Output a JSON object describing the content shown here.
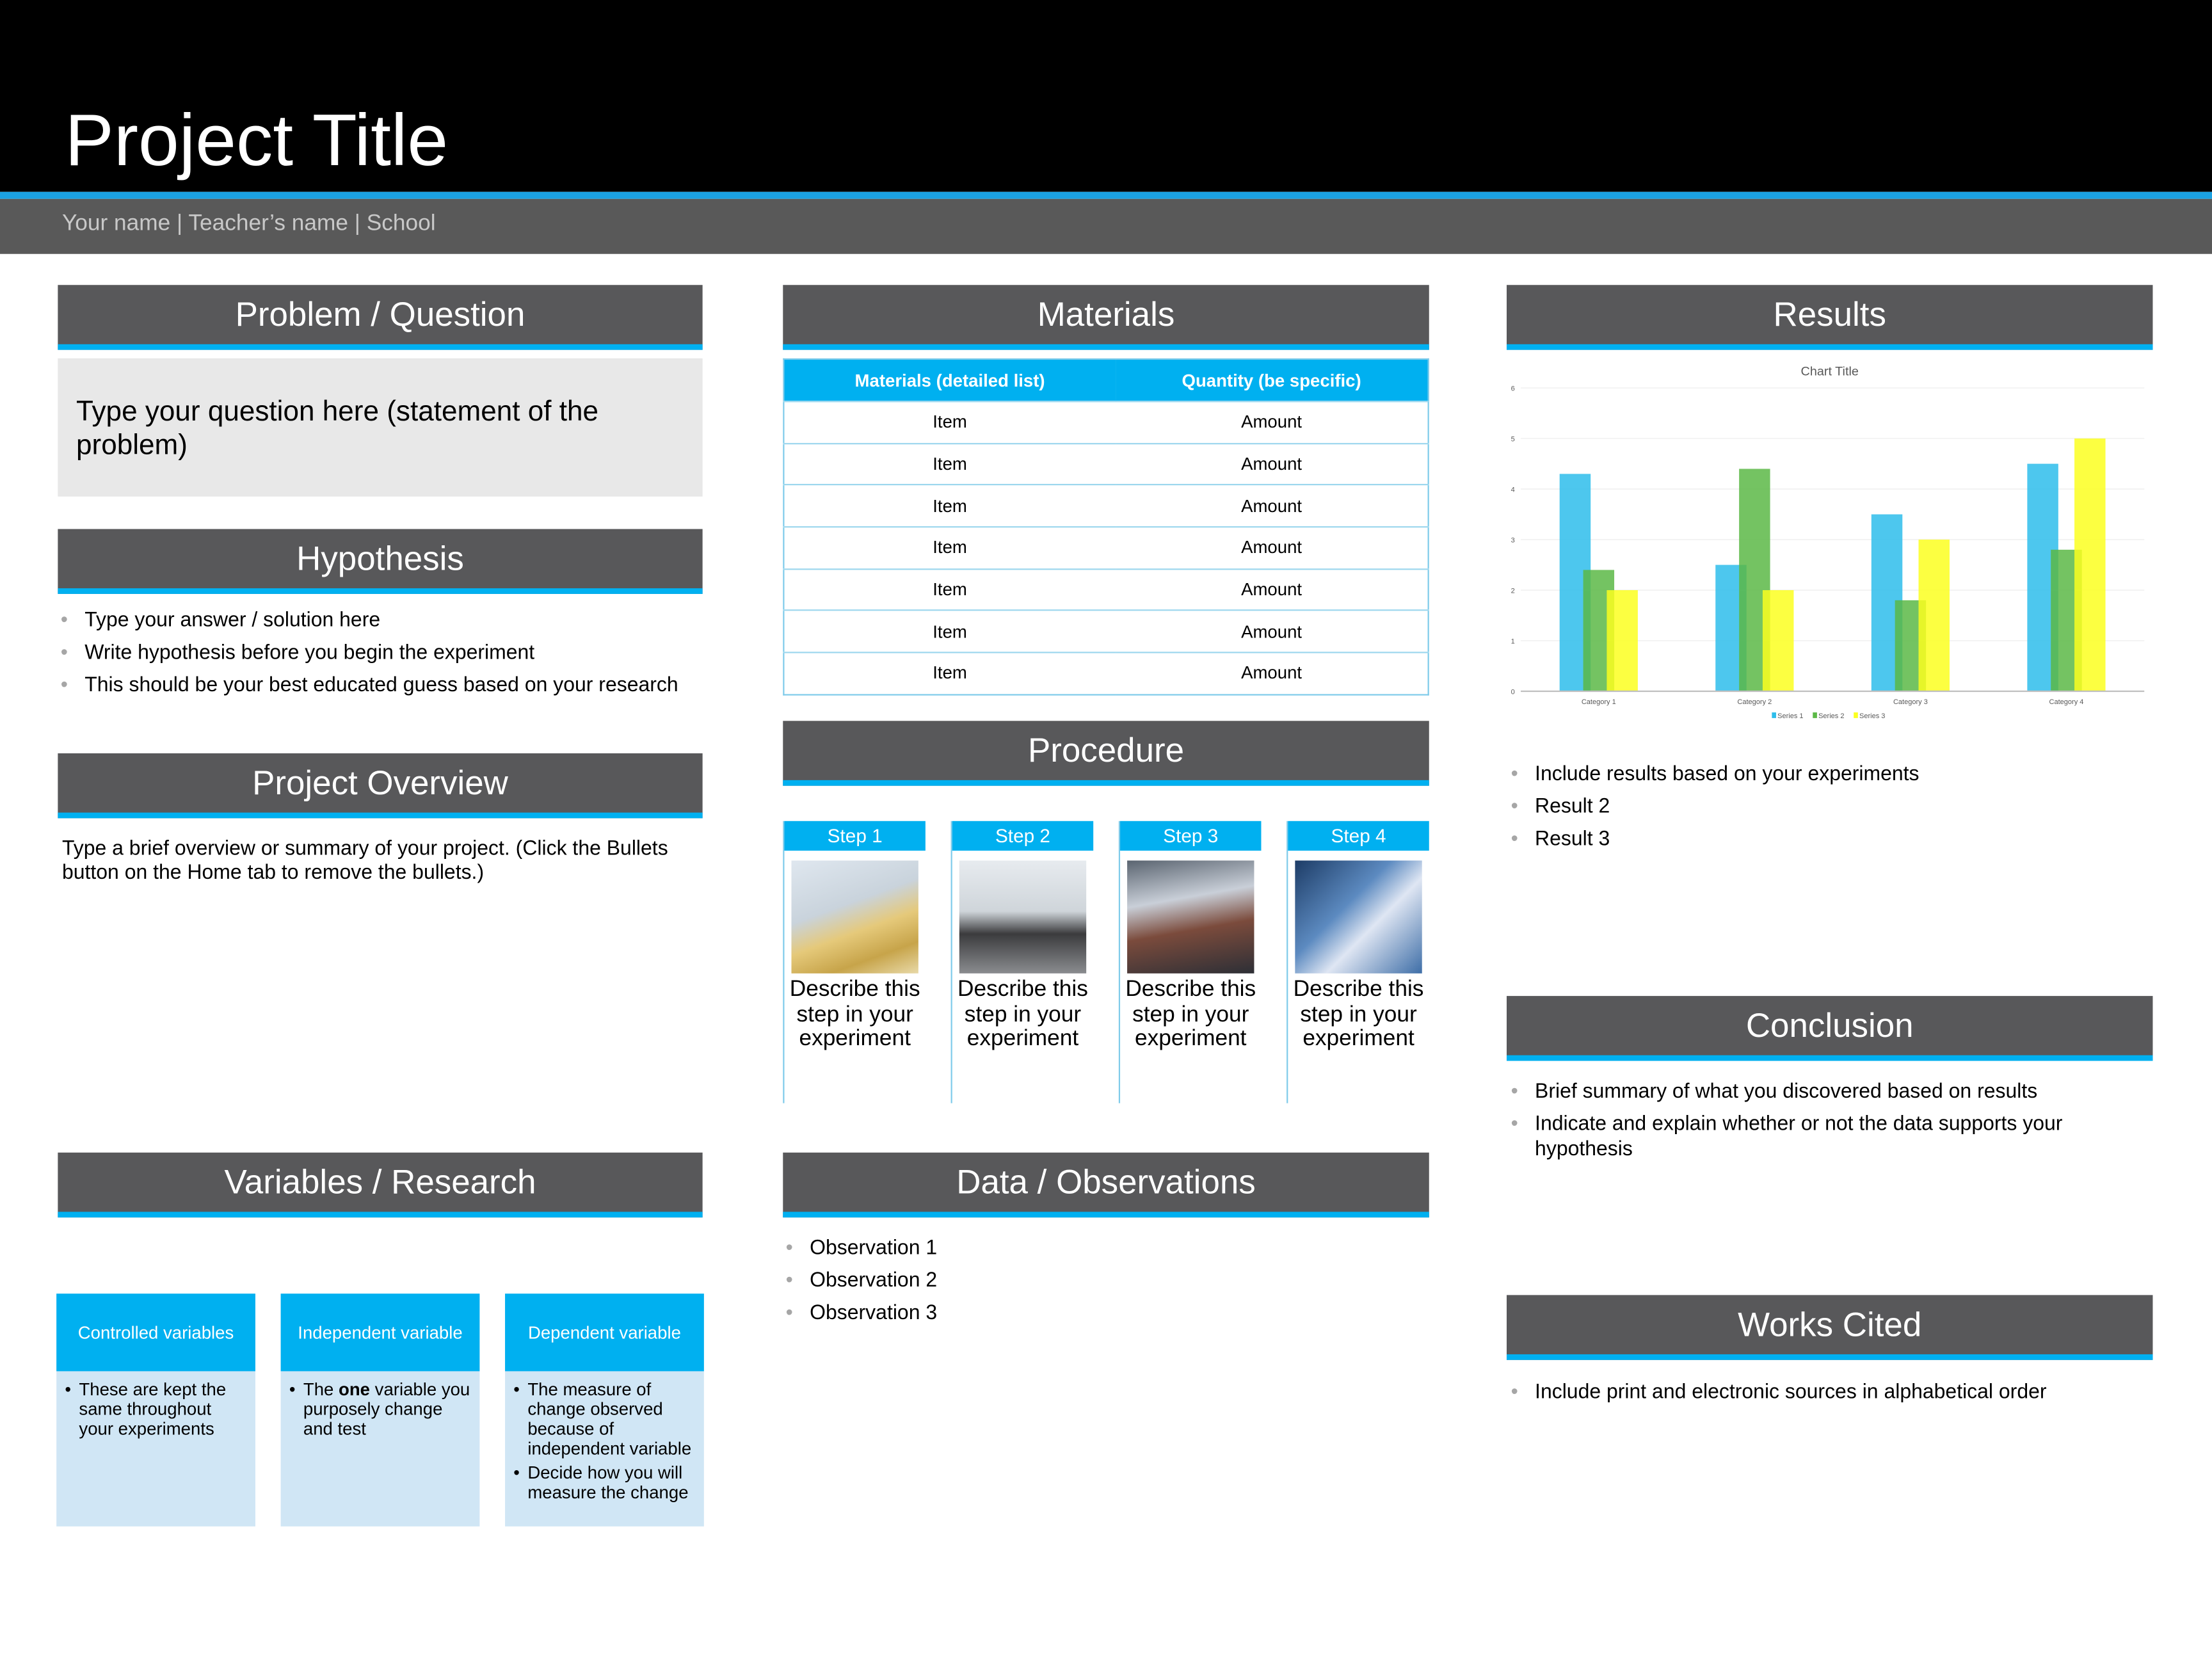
{
  "header": {
    "title": "Project Title",
    "subtitle": "Your name | Teacher’s name | School"
  },
  "problem": {
    "heading": "Problem / Question",
    "text": "Type your question here (statement of the problem)"
  },
  "hypothesis": {
    "heading": "Hypothesis",
    "bullets": [
      "Type your answer / solution here",
      "Write hypothesis before you begin the experiment",
      "This should be your best educated guess based on your research"
    ]
  },
  "overview": {
    "heading": "Project Overview",
    "text": "Type a brief overview or summary of your project. (Click the Bullets button on the Home tab to remove the bullets.)"
  },
  "variables": {
    "heading": "Variables / Research",
    "boxes": [
      {
        "title": "Controlled variables",
        "bullets": [
          "These are kept the same throughout your experiments"
        ]
      },
      {
        "title": "Independent variable",
        "bullet_pre": "The ",
        "bullet_bold": "one",
        "bullet_post": " variable you purposely change and test"
      },
      {
        "title": "Dependent variable",
        "bullets": [
          "The measure of change observed because of independent variable",
          "Decide how you will measure the change"
        ]
      }
    ]
  },
  "materials": {
    "heading": "Materials",
    "columns": [
      "Materials (detailed list)",
      "Quantity (be specific)"
    ],
    "rows": [
      [
        "Item",
        "Amount"
      ],
      [
        "Item",
        "Amount"
      ],
      [
        "Item",
        "Amount"
      ],
      [
        "Item",
        "Amount"
      ],
      [
        "Item",
        "Amount"
      ],
      [
        "Item",
        "Amount"
      ],
      [
        "Item",
        "Amount"
      ]
    ]
  },
  "procedure": {
    "heading": "Procedure",
    "steps": [
      {
        "label": "Step 1",
        "text": "Describe this step in your experiment",
        "image": "papers-photo"
      },
      {
        "label": "Step 2",
        "text": "Describe this step in your experiment",
        "image": "meeting-photo"
      },
      {
        "label": "Step 3",
        "text": "Describe this step in your experiment",
        "image": "students-lab-photo"
      },
      {
        "label": "Step 4",
        "text": "Describe this step in your experiment",
        "image": "test-tubes-photo"
      }
    ]
  },
  "data_obs": {
    "heading": "Data / Observations",
    "bullets": [
      "Observation 1",
      "Observation 2",
      "Observation 3"
    ]
  },
  "results": {
    "heading": "Results",
    "bullets": [
      "Include results based on your experiments",
      "Result 2",
      "Result 3"
    ]
  },
  "conclusion": {
    "heading": "Conclusion",
    "bullets": [
      "Brief summary of what you discovered based on results",
      "Indicate and explain whether or not the data supports your hypothesis"
    ]
  },
  "works_cited": {
    "heading": "Works Cited",
    "bullets": [
      "Include print and electronic sources in alphabetical order"
    ]
  },
  "colors": {
    "accent": "#00b0f0",
    "section_header": "#58585a"
  },
  "chart_data": {
    "type": "bar",
    "title": "Chart Title",
    "xlabel": "",
    "ylabel": "",
    "categories": [
      "Category 1",
      "Category 2",
      "Category 3",
      "Category 4"
    ],
    "series": [
      {
        "name": "Series 1",
        "values": [
          4.3,
          2.5,
          3.5,
          4.5
        ],
        "color": "#2ebdeb"
      },
      {
        "name": "Series 2",
        "values": [
          2.4,
          4.4,
          1.8,
          2.8
        ],
        "color": "#5cb947"
      },
      {
        "name": "Series 3",
        "values": [
          2,
          2,
          3,
          5
        ],
        "color": "#fbff20"
      }
    ],
    "ylim": [
      0,
      6
    ],
    "yticks": [
      "0",
      "1",
      "2",
      "3",
      "4",
      "5",
      "6"
    ],
    "grid": true,
    "legend": "bottom"
  }
}
